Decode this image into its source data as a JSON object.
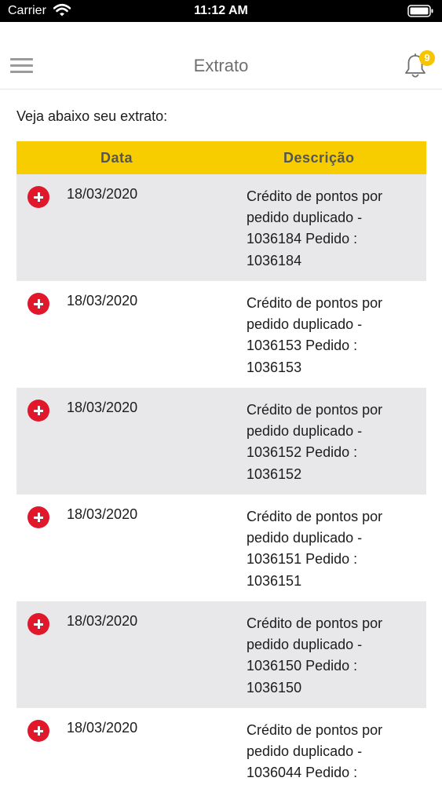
{
  "status_bar": {
    "carrier": "Carrier",
    "time": "11:12 AM"
  },
  "nav": {
    "title": "Extrato",
    "notification_count": "9"
  },
  "intro_text": "Veja abaixo seu extrato:",
  "table": {
    "headers": {
      "date": "Data",
      "description": "Descrição"
    },
    "rows": [
      {
        "date": "18/03/2020",
        "description": "Crédito de pontos por pedido duplicado - 1036184 Pedido : 1036184"
      },
      {
        "date": "18/03/2020",
        "description": "Crédito de pontos por pedido duplicado - 1036153 Pedido : 1036153"
      },
      {
        "date": "18/03/2020",
        "description": "Crédito de pontos por pedido duplicado - 1036152 Pedido : 1036152"
      },
      {
        "date": "18/03/2020",
        "description": "Crédito de pontos por pedido duplicado - 1036151 Pedido : 1036151"
      },
      {
        "date": "18/03/2020",
        "description": "Crédito de pontos por pedido duplicado - 1036150 Pedido : 1036150"
      },
      {
        "date": "18/03/2020",
        "description": "Crédito de pontos por pedido duplicado - 1036044 Pedido :"
      }
    ]
  },
  "colors": {
    "header_yellow": "#f7cd00",
    "row_shade": "#e8e8ea",
    "credit_red": "#e1182c",
    "badge_yellow": "#f7c400"
  },
  "icons": [
    "wifi-icon",
    "battery-icon",
    "menu-icon",
    "bell-icon",
    "plus-icon"
  ]
}
